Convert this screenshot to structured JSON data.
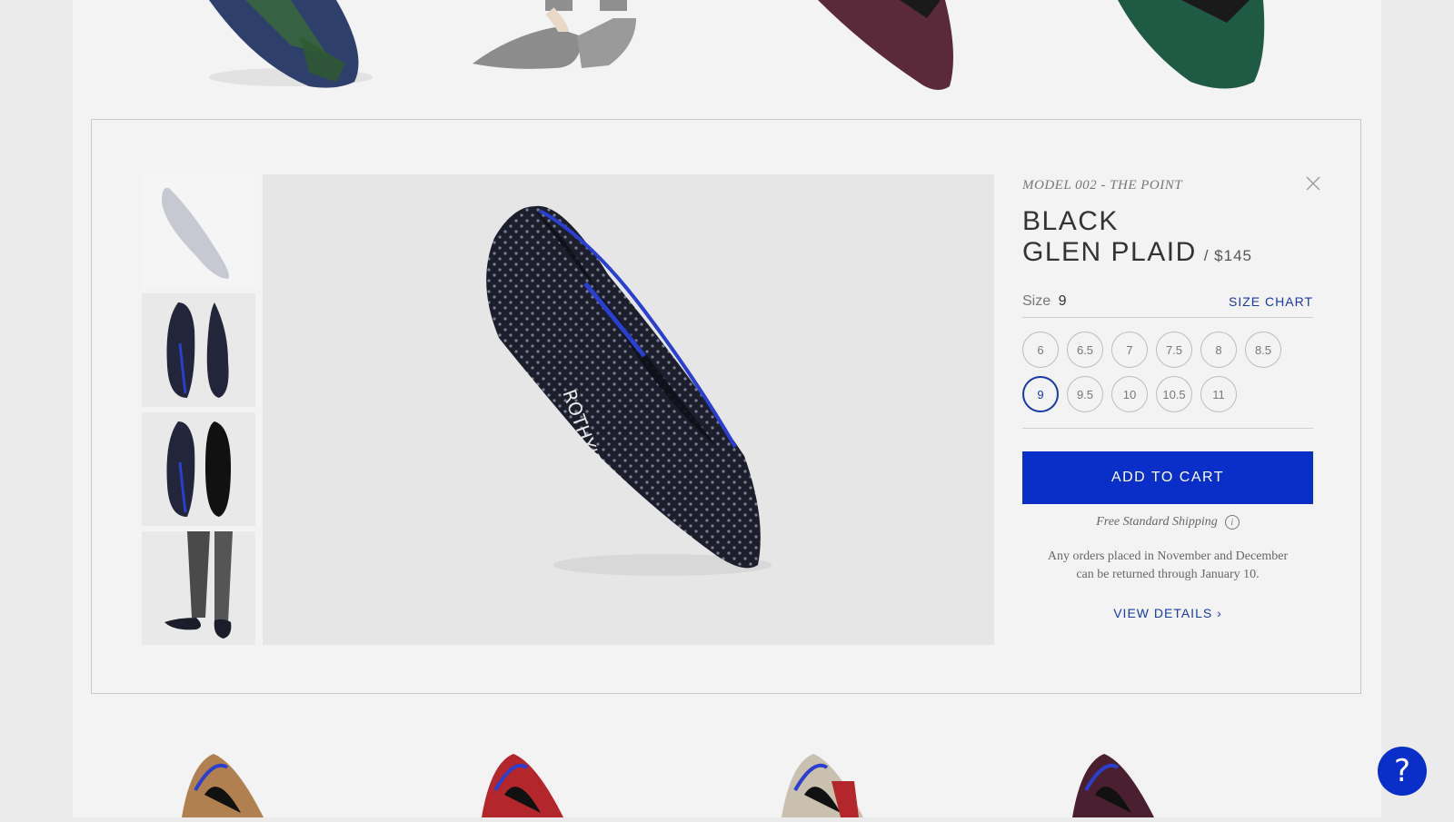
{
  "quick_view": {
    "model_name": "MODEL 002 - THE POINT",
    "title_line1": "BLACK",
    "title_line2": "GLEN PLAID",
    "price": "/ $145",
    "size_label": "Size",
    "selected_size": "9",
    "size_chart_label": "SIZE CHART",
    "sizes": [
      "6",
      "6.5",
      "7",
      "7.5",
      "8",
      "8.5",
      "9",
      "9.5",
      "10",
      "10.5",
      "11"
    ],
    "add_to_cart_label": "ADD TO CART",
    "shipping_text": "Free Standard Shipping",
    "return_note_line1": "Any orders placed in November and December",
    "return_note_line2": "can be returned through January 10.",
    "view_details_label": "VIEW DETAILS ›"
  },
  "help": {
    "label": "?"
  },
  "colors": {
    "accent": "#0a2fc9",
    "link": "#1a3aa8",
    "top_shoes": [
      "#2f4a6b",
      "#8a8a8a",
      "#5a2a3a",
      "#1e5a44"
    ],
    "bottom_shoes": [
      "#b08050",
      "#b3262c",
      "#c9c0b0",
      "#4a2030"
    ]
  }
}
